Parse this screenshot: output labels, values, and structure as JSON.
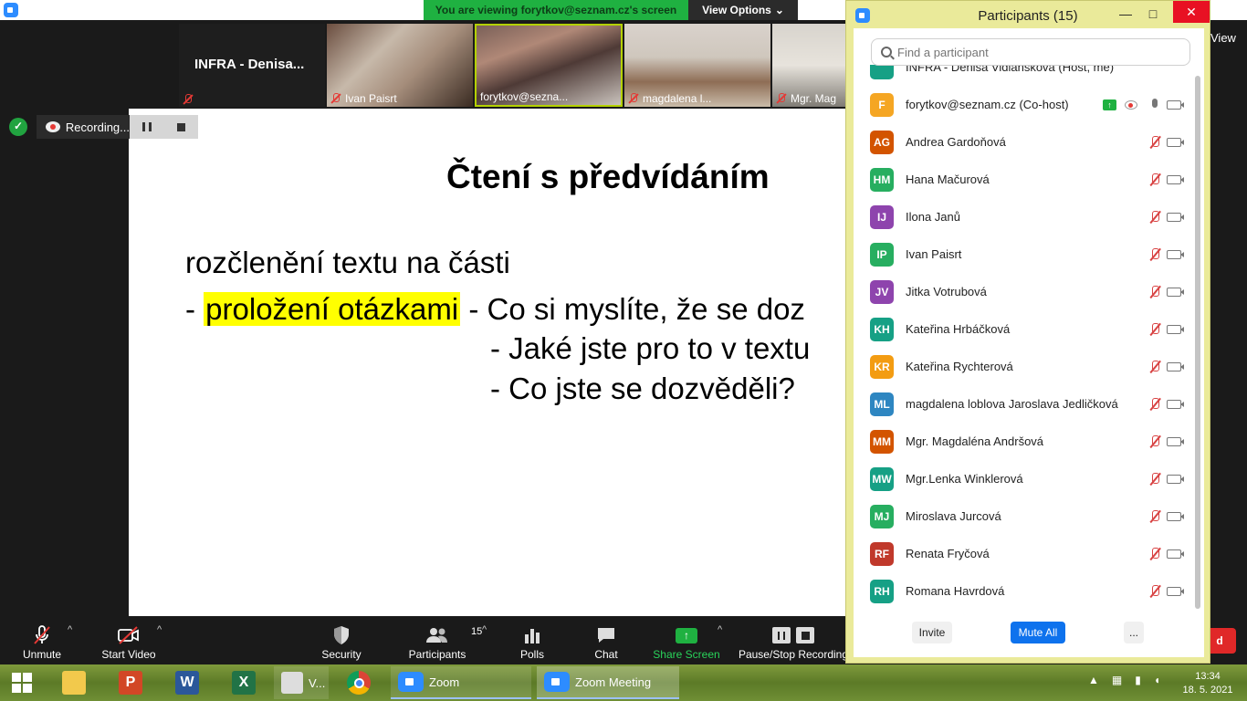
{
  "title_bar": {
    "viewing_banner": "You are viewing forytkov@seznam.cz's screen",
    "view_options": "View Options",
    "view_peek": "View"
  },
  "video_strip": [
    {
      "name": "INFRA - Denisa..."
    },
    {
      "name": "Ivan Paisrt"
    },
    {
      "name": "forytkov@sezna..."
    },
    {
      "name": "magdalena l..."
    },
    {
      "name": "Mgr. Mag"
    }
  ],
  "recording": {
    "label": "Recording..."
  },
  "slide": {
    "title": "Čtení s předvídáním",
    "line1": "rozčlenění textu na části",
    "line2_prefix": "- ",
    "line2_highlight": "proložení otázkami",
    "line2_rest": " - Co si myslíte, že se doz",
    "line3": "- Jaké jste pro to v textu",
    "line4": "- Co jste se dozvěděli?"
  },
  "toolbar": {
    "unmute": "Unmute",
    "start_video": "Start Video",
    "security": "Security",
    "participants": "Participants",
    "participants_count": "15",
    "polls": "Polls",
    "chat": "Chat",
    "share_screen": "Share Screen",
    "pause_stop_recording": "Pause/Stop Recording",
    "end": "d"
  },
  "participants_panel": {
    "title": "Participants (15)",
    "search_placeholder": "Find a participant",
    "partial_top_row": "INFRA - Denisa Vidlanskova (Host, me)",
    "participants": [
      {
        "initials": "F",
        "name": "forytkov@seznam.cz (Co-host)",
        "color": "#f5a623",
        "sharing": true,
        "mic": "on"
      },
      {
        "initials": "AG",
        "name": "Andrea Gardoňová",
        "color": "#d35400",
        "mic": "muted"
      },
      {
        "initials": "HM",
        "name": "Hana Mačurová",
        "color": "#27ae60",
        "mic": "muted"
      },
      {
        "initials": "IJ",
        "name": "Ilona Janů",
        "color": "#8e44ad",
        "mic": "muted"
      },
      {
        "initials": "IP",
        "name": "Ivan Paisrt",
        "color": "#27ae60",
        "mic": "muted"
      },
      {
        "initials": "JV",
        "name": "Jitka Votrubová",
        "color": "#8e44ad",
        "mic": "muted"
      },
      {
        "initials": "KH",
        "name": "Kateřina Hrbáčková",
        "color": "#16a085",
        "mic": "muted"
      },
      {
        "initials": "KR",
        "name": "Kateřina Rychterová",
        "color": "#f39c12",
        "mic": "muted"
      },
      {
        "initials": "ML",
        "name": "magdalena loblova Jaroslava Jedličková",
        "color": "#2e86c1",
        "mic": "muted"
      },
      {
        "initials": "MM",
        "name": "Mgr. Magdaléna Andršová",
        "color": "#d35400",
        "mic": "muted"
      },
      {
        "initials": "MW",
        "name": "Mgr.Lenka Winklerová",
        "color": "#16a085",
        "mic": "muted"
      },
      {
        "initials": "MJ",
        "name": "Miroslava Jurcová",
        "color": "#27ae60",
        "mic": "muted"
      },
      {
        "initials": "RF",
        "name": "Renata Fryčová",
        "color": "#c0392b",
        "mic": "muted"
      },
      {
        "initials": "RH",
        "name": "Romana Havrdová",
        "color": "#16a085",
        "mic": "muted"
      }
    ],
    "invite": "Invite",
    "mute_all": "Mute All",
    "more": "..."
  },
  "taskbar": {
    "vlc_label": "V...",
    "zoom_label": "Zoom",
    "zoom_meeting_label": "Zoom Meeting",
    "time": "13:34",
    "date": "18. 5. 2021"
  }
}
